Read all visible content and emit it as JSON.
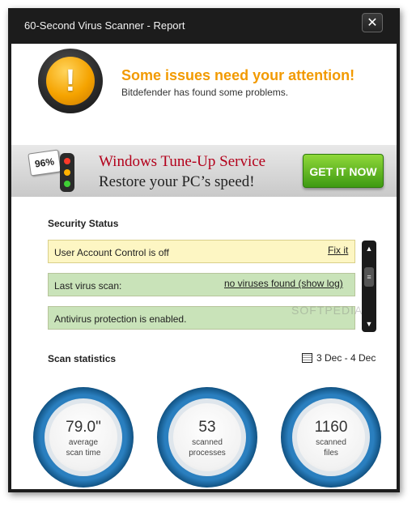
{
  "window": {
    "title": "60-Second Virus Scanner - Report",
    "close_glyph": "✕"
  },
  "alert": {
    "icon": "warning-icon",
    "glyph": "!",
    "headline": "Some issues need your attention!",
    "subline": "Bitdefender has found some problems."
  },
  "ad": {
    "badge": "96%",
    "title": "Windows Tune-Up Service",
    "subtitle": "Restore your PC’s speed!",
    "button": "GET IT NOW"
  },
  "security": {
    "title": "Security Status",
    "items": [
      {
        "label": "User Account Control is off",
        "action": "Fix it",
        "status": "warning"
      },
      {
        "label": "Last virus scan:",
        "action": "no viruses found (show log)",
        "status": "ok"
      },
      {
        "label": "Antivirus protection is enabled.",
        "action": "",
        "status": "ok"
      }
    ],
    "scroll_up": "▲",
    "scroll_thumb": "≡",
    "scroll_down": "▼"
  },
  "stats": {
    "title": "Scan statistics",
    "date_range": "3 Dec - 4 Dec",
    "items": [
      {
        "value": "79.0\"",
        "caption1": "average",
        "caption2": "scan time"
      },
      {
        "value": "53",
        "caption1": "scanned",
        "caption2": "processes"
      },
      {
        "value": "1160",
        "caption1": "scanned",
        "caption2": "files"
      }
    ]
  },
  "watermark": "SOFTPEDIA",
  "colors": {
    "accent_orange": "#f29a00",
    "ad_red": "#b3001b",
    "ok_green": "#c9e3b9",
    "warn_yellow": "#fdf6c3",
    "ring_blue": "#2a7fbf"
  }
}
